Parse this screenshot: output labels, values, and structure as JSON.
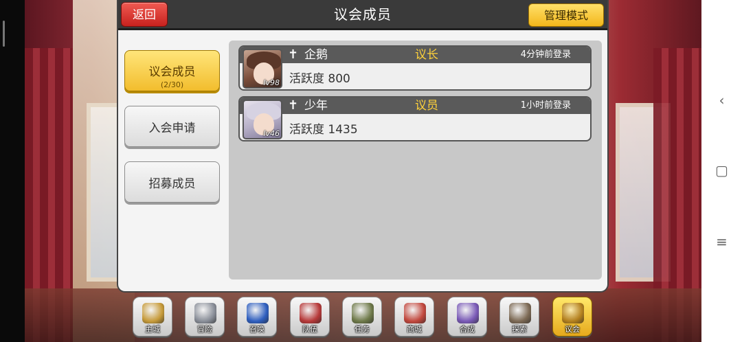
{
  "header": {
    "back_label": "返回",
    "title": "议会成员",
    "manage_label": "管理模式"
  },
  "sidebar": {
    "items": [
      {
        "label": "议会成员",
        "sub": "(2/30)"
      },
      {
        "label": "入会申请"
      },
      {
        "label": "招募成员"
      }
    ]
  },
  "members": [
    {
      "name": "企鹅",
      "role": "议长",
      "login": "4分钟前登录",
      "activity": "活跃度 800",
      "level": "lv98"
    },
    {
      "name": "少年",
      "role": "议员",
      "login": "1小时前登录",
      "activity": "活跃度 1435",
      "level": "lv46"
    }
  ],
  "bottom_menu": [
    {
      "label": "主城",
      "icon": "crown-castle-icon",
      "color": "#c79b3a"
    },
    {
      "label": "冒险",
      "icon": "crossed-swords-icon",
      "color": "#8a8f99"
    },
    {
      "label": "召唤",
      "icon": "summon-card-icon",
      "color": "#2f5fbf"
    },
    {
      "label": "队伍",
      "icon": "winged-shield-icon",
      "color": "#b73a3a"
    },
    {
      "label": "任务",
      "icon": "scroll-quest-icon",
      "color": "#6f7a4a"
    },
    {
      "label": "商城",
      "icon": "shop-awning-icon",
      "color": "#c2483e"
    },
    {
      "label": "合成",
      "icon": "potion-craft-icon",
      "color": "#7a5ab7"
    },
    {
      "label": "探索",
      "icon": "shovel-explore-icon",
      "color": "#7d6a55"
    },
    {
      "label": "议会",
      "icon": "guild-crest-icon",
      "color": "#b3801e"
    }
  ],
  "colors": {
    "header_bg": "#3a3a3a",
    "back_button": "#e0423b",
    "accent_yellow": "#f5c431",
    "role_text": "#ffd23a"
  }
}
